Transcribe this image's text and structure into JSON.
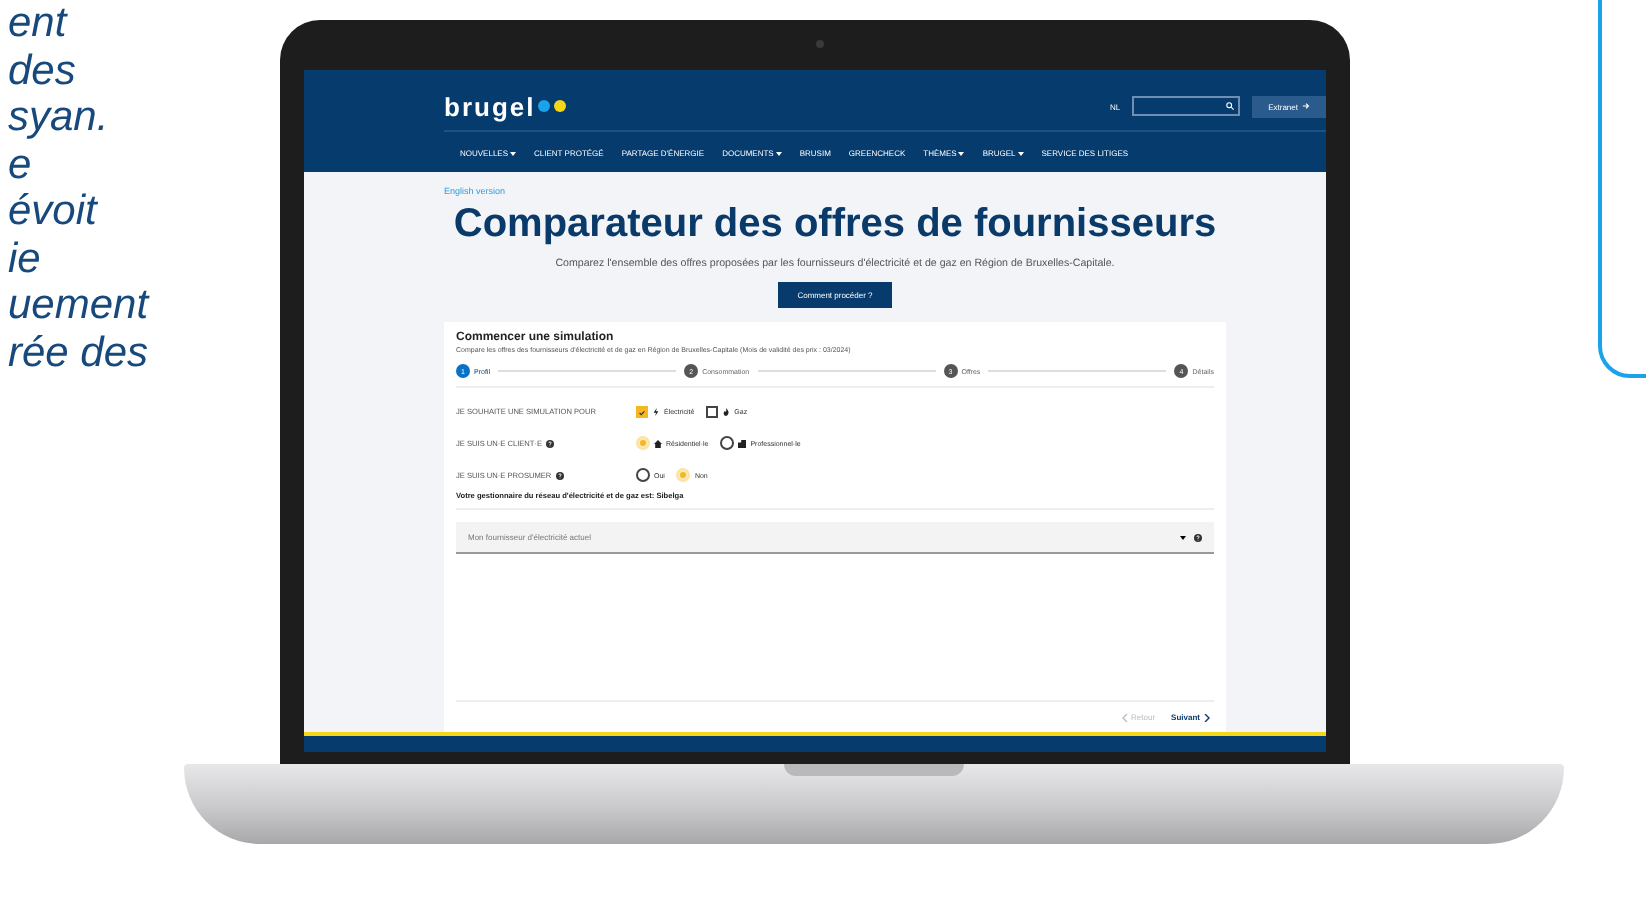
{
  "side_text_lines": [
    "ent",
    "des",
    "syan.",
    "e",
    "évoit",
    "ie",
    "uement",
    "rée des"
  ],
  "site": {
    "logo": "brugel",
    "language": "NL",
    "extranet_button": "Extranet",
    "nav": [
      {
        "label": "NOUVELLES",
        "dropdown": true
      },
      {
        "label": "CLIENT PROTÉGÉ",
        "dropdown": false
      },
      {
        "label": "PARTAGE D'ÉNERGIE",
        "dropdown": false
      },
      {
        "label": "DOCUMENTS",
        "dropdown": true
      },
      {
        "label": "BRUSIM",
        "dropdown": false
      },
      {
        "label": "GREENCHECK",
        "dropdown": false
      },
      {
        "label": "THÈMES",
        "dropdown": true
      },
      {
        "label": "BRUGEL",
        "dropdown": true
      },
      {
        "label": "SERVICE DES LITIGES",
        "dropdown": false
      }
    ]
  },
  "english_link": "English version",
  "title": "Comparateur des offres de fournisseurs",
  "subtitle": "Comparez l'ensemble des offres proposées par les fournisseurs d'électricité et de gaz en Région de Bruxelles-Capitale.",
  "help_button": "Comment procéder ?",
  "simulation": {
    "title": "Commencer une simulation",
    "description": "Compare les offres des fournisseurs d'électricité et de gaz en Région de Bruxelles-Capitale (Mois de validité des prix : 03/2024)",
    "steps": [
      {
        "number": "1",
        "label": "Profil",
        "selected": true
      },
      {
        "number": "2",
        "label": "Consommation",
        "selected": false
      },
      {
        "number": "3",
        "label": "Offres",
        "selected": false
      },
      {
        "number": "4",
        "label": "Détails",
        "selected": false
      }
    ],
    "questions": [
      {
        "label": "JE SOUHAITE UNE SIMULATION POUR",
        "help": false,
        "kind": "checkbox",
        "options": [
          {
            "label": "Électricité",
            "checked": true
          },
          {
            "label": "Gaz",
            "checked": false
          }
        ]
      },
      {
        "label": "JE SUIS UN·E CLIENT·E",
        "help": true,
        "kind": "radio",
        "options": [
          {
            "label": "Résidentiel·le",
            "selected": true
          },
          {
            "label": "Professionnel·le",
            "selected": false
          }
        ]
      },
      {
        "label": "JE SUIS UN·E PROSUMER",
        "help": true,
        "kind": "radio",
        "options": [
          {
            "label": "Oui",
            "selected": false
          },
          {
            "label": "Non",
            "selected": true
          }
        ]
      }
    ],
    "grid_operator": "Votre gestionnaire du réseau d'électricité et de gaz est: Sibelga",
    "supplier_select": {
      "placeholder": "Mon fournisseur d'électricité actuel"
    },
    "back_button": {
      "label": "Retour",
      "disabled": true
    },
    "next_button": {
      "label": "Suivant",
      "disabled": false
    }
  }
}
